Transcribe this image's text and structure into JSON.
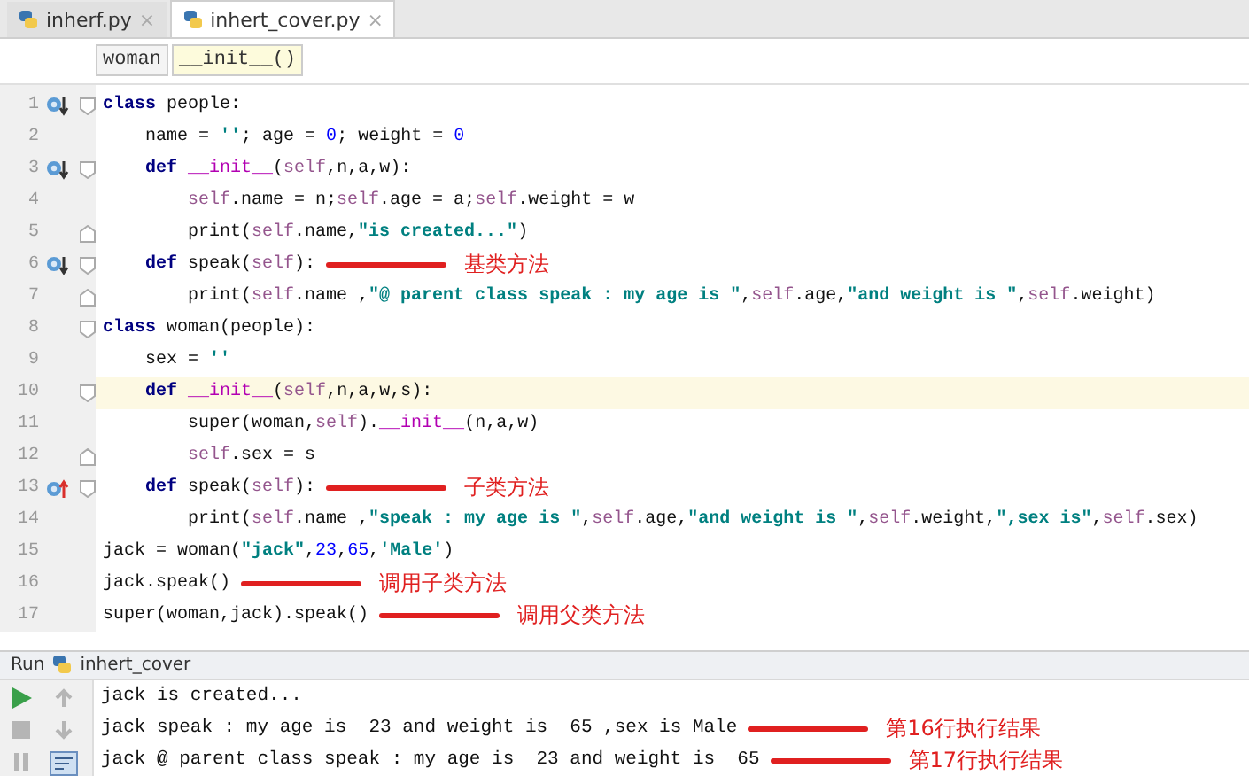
{
  "tabs": [
    {
      "label": "inherf.py",
      "selected": false,
      "close": "×"
    },
    {
      "label": "inhert_cover.py",
      "selected": true,
      "close": "×"
    }
  ],
  "breadcrumbs": [
    {
      "label": "woman",
      "selected": false
    },
    {
      "label": "__init__()",
      "selected": true
    }
  ],
  "code_lines": [
    {
      "number": "1",
      "gutter_icon": {
        "kind": "overridden"
      },
      "fold_marker": {
        "kind": "start"
      },
      "highlighted": false,
      "tokens": [
        {
          "kind": "keyword",
          "t": "class"
        },
        {
          "kind": "plain",
          "t": " people:"
        }
      ],
      "children": [
        {
          "number": "2",
          "highlighted": false,
          "tokens": [
            {
              "kind": "plain",
              "t": "name = "
            },
            {
              "kind": "string",
              "t": "''"
            },
            {
              "kind": "plain",
              "t": "; age = "
            },
            {
              "kind": "number",
              "t": "0"
            },
            {
              "kind": "plain",
              "t": "; weight = "
            },
            {
              "kind": "number",
              "t": "0"
            }
          ]
        },
        {
          "number": "3",
          "gutter_icon": {
            "kind": "overridden"
          },
          "fold_marker": {
            "kind": "start"
          },
          "highlighted": false,
          "tokens": [
            {
              "kind": "keyword",
              "t": "def"
            },
            {
              "kind": "function",
              "t": " __init__"
            },
            {
              "kind": "plain",
              "t": "("
            },
            {
              "kind": "self",
              "t": "self"
            },
            {
              "kind": "plain",
              "t": ",n,a,w):"
            }
          ],
          "children": [
            {
              "number": "4",
              "highlighted": false,
              "tokens": [
                {
                  "kind": "self",
                  "t": "self"
                },
                {
                  "kind": "plain",
                  "t": ".name = n;"
                },
                {
                  "kind": "self",
                  "t": "self"
                },
                {
                  "kind": "plain",
                  "t": ".age = a;"
                },
                {
                  "kind": "self",
                  "t": "self"
                },
                {
                  "kind": "plain",
                  "t": ".weight = w"
                }
              ]
            },
            {
              "number": "5",
              "fold_marker": {
                "kind": "end"
              },
              "highlighted": false,
              "tokens": [
                {
                  "kind": "plain",
                  "t": "print("
                },
                {
                  "kind": "self",
                  "t": "self"
                },
                {
                  "kind": "plain",
                  "t": ".name,"
                },
                {
                  "kind": "string",
                  "t": "\"is created...\""
                },
                {
                  "kind": "plain",
                  "t": ")"
                }
              ]
            }
          ]
        },
        {
          "number": "6",
          "gutter_icon": {
            "kind": "overridden"
          },
          "fold_marker": {
            "kind": "start"
          },
          "highlighted": false,
          "annotation": "基类方法",
          "tokens": [
            {
              "kind": "keyword",
              "t": "def"
            },
            {
              "kind": "plain",
              "t": " speak("
            },
            {
              "kind": "self",
              "t": "self"
            },
            {
              "kind": "plain",
              "t": "):"
            }
          ],
          "children": [
            {
              "number": "7",
              "fold_marker": {
                "kind": "end"
              },
              "highlighted": false,
              "tokens": [
                {
                  "kind": "plain",
                  "t": "print("
                },
                {
                  "kind": "self",
                  "t": "self"
                },
                {
                  "kind": "plain",
                  "t": ".name ,"
                },
                {
                  "kind": "string",
                  "t": "\"@ parent class speak : my age is \""
                },
                {
                  "kind": "plain",
                  "t": ","
                },
                {
                  "kind": "self",
                  "t": "self"
                },
                {
                  "kind": "plain",
                  "t": ".age,"
                },
                {
                  "kind": "string",
                  "t": "\"and weight is \""
                },
                {
                  "kind": "plain",
                  "t": ","
                },
                {
                  "kind": "self",
                  "t": "self"
                },
                {
                  "kind": "plain",
                  "t": ".weight)"
                }
              ]
            }
          ]
        }
      ]
    },
    {
      "number": "8",
      "fold_marker": {
        "kind": "start"
      },
      "highlighted": false,
      "tokens": [
        {
          "kind": "keyword",
          "t": "class"
        },
        {
          "kind": "plain",
          "t": " woman(people):"
        }
      ],
      "children": [
        {
          "number": "9",
          "highlighted": false,
          "tokens": [
            {
              "kind": "plain",
              "t": "sex = "
            },
            {
              "kind": "string",
              "t": "''"
            }
          ]
        },
        {
          "number": "10",
          "fold_marker": {
            "kind": "start"
          },
          "highlighted": true,
          "tokens": [
            {
              "kind": "keyword",
              "t": "def"
            },
            {
              "kind": "function",
              "t": " __init__"
            },
            {
              "kind": "plain",
              "t": "("
            },
            {
              "kind": "self",
              "t": "self"
            },
            {
              "kind": "plain",
              "t": ",n,a,w,s):"
            }
          ],
          "children": [
            {
              "number": "11",
              "highlighted": false,
              "tokens": [
                {
                  "kind": "plain",
                  "t": "super(woman,"
                },
                {
                  "kind": "self",
                  "t": "self"
                },
                {
                  "kind": "plain",
                  "t": ")."
                },
                {
                  "kind": "function",
                  "t": "__init__"
                },
                {
                  "kind": "plain",
                  "t": "(n,a,w)"
                }
              ]
            },
            {
              "number": "12",
              "fold_marker": {
                "kind": "end"
              },
              "highlighted": false,
              "tokens": [
                {
                  "kind": "self",
                  "t": "self"
                },
                {
                  "kind": "plain",
                  "t": ".sex = s"
                }
              ]
            }
          ]
        },
        {
          "number": "13",
          "gutter_icon": {
            "kind": "overrides"
          },
          "fold_marker": {
            "kind": "start"
          },
          "highlighted": false,
          "annotation": "子类方法",
          "tokens": [
            {
              "kind": "keyword",
              "t": "def"
            },
            {
              "kind": "plain",
              "t": " speak("
            },
            {
              "kind": "self",
              "t": "self"
            },
            {
              "kind": "plain",
              "t": "):"
            }
          ],
          "children": [
            {
              "number": "14",
              "highlighted": false,
              "tokens": [
                {
                  "kind": "plain",
                  "t": "print("
                },
                {
                  "kind": "self",
                  "t": "self"
                },
                {
                  "kind": "plain",
                  "t": ".name ,"
                },
                {
                  "kind": "string",
                  "t": "\"speak : my age is \""
                },
                {
                  "kind": "plain",
                  "t": ","
                },
                {
                  "kind": "self",
                  "t": "self"
                },
                {
                  "kind": "plain",
                  "t": ".age,"
                },
                {
                  "kind": "string",
                  "t": "\"and weight is \""
                },
                {
                  "kind": "plain",
                  "t": ","
                },
                {
                  "kind": "self",
                  "t": "self"
                },
                {
                  "kind": "plain",
                  "t": ".weight,"
                },
                {
                  "kind": "string",
                  "t": "\",sex is\""
                },
                {
                  "kind": "plain",
                  "t": ","
                },
                {
                  "kind": "self",
                  "t": "self"
                },
                {
                  "kind": "plain",
                  "t": ".sex)"
                }
              ]
            }
          ]
        }
      ]
    },
    {
      "number": "15",
      "highlighted": false,
      "tokens": [
        {
          "kind": "plain",
          "t": "jack = woman("
        },
        {
          "kind": "string",
          "t": "\"jack\""
        },
        {
          "kind": "plain",
          "t": ","
        },
        {
          "kind": "number",
          "t": "23"
        },
        {
          "kind": "plain",
          "t": ","
        },
        {
          "kind": "number",
          "t": "65"
        },
        {
          "kind": "plain",
          "t": ","
        },
        {
          "kind": "string",
          "t": "'Male'"
        },
        {
          "kind": "plain",
          "t": ")"
        }
      ]
    },
    {
      "number": "16",
      "highlighted": false,
      "annotation": "调用子类方法",
      "tokens": [
        {
          "kind": "plain",
          "t": "jack.speak()"
        }
      ]
    },
    {
      "number": "17",
      "highlighted": false,
      "annotation": "调用父类方法",
      "tokens": [
        {
          "kind": "plain",
          "t": "super(woman,jack).speak()"
        }
      ]
    }
  ],
  "run_panel": {
    "title": "Run",
    "config": "inhert_cover",
    "output": [
      {
        "text": "jack is created..."
      },
      {
        "text": "jack speak : my age is  23 and weight is  65 ,sex is Male",
        "annotation": "第16行执行结果"
      },
      {
        "text": "jack @ parent class speak : my age is  23 and weight is  65",
        "annotation": "第17行执行结果"
      }
    ]
  }
}
